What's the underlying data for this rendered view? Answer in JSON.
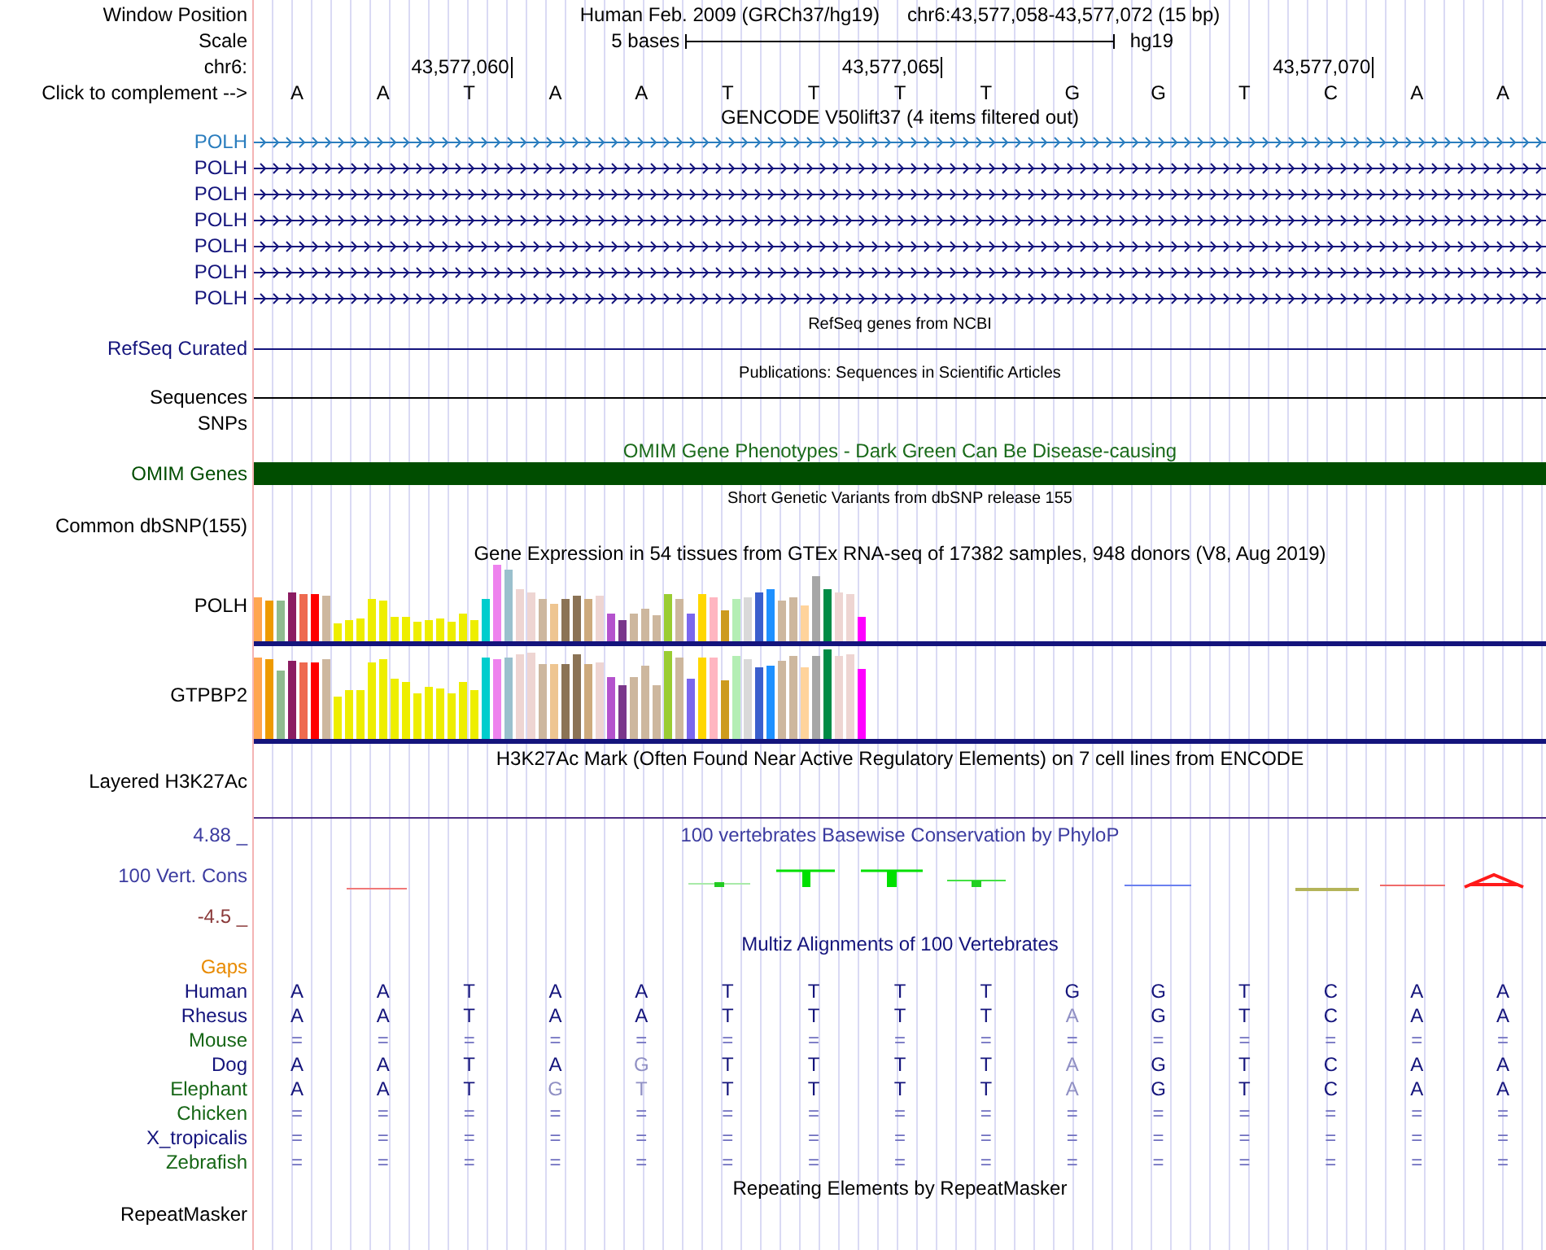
{
  "position": {
    "label": "Window Position",
    "assembly": "Human Feb. 2009 (GRCh37/hg19)",
    "range": "chr6:43,577,058-43,577,072 (15 bp)"
  },
  "scale": {
    "label": "Scale",
    "span": "5 bases",
    "db": "hg19"
  },
  "ruler": {
    "label": "chr6:",
    "ticks": [
      "43,577,060",
      "43,577,065",
      "43,577,070"
    ]
  },
  "bases": {
    "label": "Click to complement -->",
    "letters": [
      "A",
      "A",
      "T",
      "A",
      "A",
      "T",
      "T",
      "T",
      "T",
      "G",
      "G",
      "T",
      "C",
      "A",
      "A"
    ]
  },
  "tracks": [
    {
      "kind": "genes",
      "title": {
        "text": "GENCODE V50lift37 (4 items filtered out)",
        "color": "#000000"
      },
      "rows": [
        {
          "kind": "gene",
          "label": "POLH",
          "color": "#2a7dbe"
        },
        {
          "kind": "gene",
          "label": "POLH",
          "color": "#14147c"
        },
        {
          "kind": "gene",
          "label": "POLH",
          "color": "#14147c"
        },
        {
          "kind": "gene",
          "label": "POLH",
          "color": "#14147c"
        },
        {
          "kind": "gene",
          "label": "POLH",
          "color": "#14147c"
        },
        {
          "kind": "gene",
          "label": "POLH",
          "color": "#14147c"
        },
        {
          "kind": "gene",
          "label": "POLH",
          "color": "#14147c"
        }
      ]
    },
    {
      "kind": "composite",
      "title": {
        "text": "RefSeq genes from NCBI",
        "color": "#000000"
      },
      "rows": [
        {
          "kind": "line",
          "label": "RefSeq Curated",
          "color": "#14147c"
        }
      ]
    },
    {
      "kind": "composite",
      "title": {
        "text": "Publications: Sequences in Scientific Articles",
        "color": "#000000"
      },
      "rows": [
        {
          "kind": "line",
          "label": "Sequences",
          "color": "#000000"
        },
        {
          "kind": "empty",
          "label": "SNPs",
          "color": "#000000"
        }
      ]
    },
    {
      "kind": "standard",
      "title": {
        "text": "OMIM Gene Phenotypes - Dark Green Can Be Disease-causing",
        "color": "#1b6b1b"
      },
      "rows": [
        {
          "kind": "bar",
          "label": "OMIM Genes",
          "color": "#004d00"
        }
      ]
    },
    {
      "kind": "composite",
      "title": {
        "text": "Short Genetic Variants from dbSNP release 155",
        "color": "#000000"
      },
      "rows": [
        {
          "kind": "empty",
          "label": "Common dbSNP(155)",
          "color": "#000000"
        }
      ]
    },
    {
      "kind": "standard",
      "title": {
        "text": "Gene Expression in 54 tissues from GTEx RNA-seq of 17382 samples, 948 donors (V8, Aug 2019)",
        "color": "#000000"
      },
      "rows": [
        {
          "kind": "expression",
          "label": "POLH",
          "color": "#000000"
        },
        {
          "kind": "expression",
          "label": "GTPBP2",
          "color": "#000000"
        }
      ]
    },
    {
      "kind": "standard",
      "title": {
        "text": "H3K27Ac Mark (Often Found Near Active Regulatory Elements) on 7 cell lines from ENCODE",
        "color": "#000000"
      },
      "rows": [
        {
          "kind": "signal",
          "label": "Layered H3K27Ac",
          "color": "#000000"
        }
      ]
    },
    {
      "kind": "conservation",
      "title": {
        "text": "100 vertebrates Basewise Conservation by PhyloP",
        "color": "#3c3ca0"
      },
      "label": "100 Vert. Cons",
      "color": "#3c3ca0",
      "max": "4.88 _",
      "min": {
        "text": "-4.5 _",
        "color": "#8b3a3a"
      }
    },
    {
      "kind": "alignment",
      "title": {
        "text": "Multiz Alignments of 100 Vertebrates",
        "color": "#14147c"
      },
      "rows": [
        {
          "kind": "gaps",
          "label": "Gaps",
          "color": "#e88a00"
        },
        {
          "kind": "aligned",
          "label": "Human",
          "color": "#14147c",
          "bases": [
            {
              "text": "A",
              "mismatch": false
            },
            {
              "text": "A",
              "mismatch": false
            },
            {
              "text": "T",
              "mismatch": false
            },
            {
              "text": "A",
              "mismatch": false
            },
            {
              "text": "A",
              "mismatch": false
            },
            {
              "text": "T",
              "mismatch": false
            },
            {
              "text": "T",
              "mismatch": false
            },
            {
              "text": "T",
              "mismatch": false
            },
            {
              "text": "T",
              "mismatch": false
            },
            {
              "text": "G",
              "mismatch": false
            },
            {
              "text": "G",
              "mismatch": false
            },
            {
              "text": "T",
              "mismatch": false
            },
            {
              "text": "C",
              "mismatch": false
            },
            {
              "text": "A",
              "mismatch": false
            },
            {
              "text": "A",
              "mismatch": false
            }
          ]
        },
        {
          "kind": "aligned",
          "label": "Rhesus",
          "color": "#14147c",
          "bases": [
            {
              "text": "A",
              "mismatch": false
            },
            {
              "text": "A",
              "mismatch": false
            },
            {
              "text": "T",
              "mismatch": false
            },
            {
              "text": "A",
              "mismatch": false
            },
            {
              "text": "A",
              "mismatch": false
            },
            {
              "text": "T",
              "mismatch": false
            },
            {
              "text": "T",
              "mismatch": false
            },
            {
              "text": "T",
              "mismatch": false
            },
            {
              "text": "T",
              "mismatch": false
            },
            {
              "text": "A",
              "mismatch": true
            },
            {
              "text": "G",
              "mismatch": false
            },
            {
              "text": "T",
              "mismatch": false
            },
            {
              "text": "C",
              "mismatch": false
            },
            {
              "text": "A",
              "mismatch": false
            },
            {
              "text": "A",
              "mismatch": false
            }
          ]
        },
        {
          "kind": "unaligned",
          "label": "Mouse",
          "color": "#166616",
          "bases": [
            {
              "text": "=",
              "mismatch": false
            },
            {
              "text": "=",
              "mismatch": false
            },
            {
              "text": "=",
              "mismatch": false
            },
            {
              "text": "=",
              "mismatch": false
            },
            {
              "text": "=",
              "mismatch": false
            },
            {
              "text": "=",
              "mismatch": false
            },
            {
              "text": "=",
              "mismatch": false
            },
            {
              "text": "=",
              "mismatch": false
            },
            {
              "text": "=",
              "mismatch": false
            },
            {
              "text": "=",
              "mismatch": false
            },
            {
              "text": "=",
              "mismatch": false
            },
            {
              "text": "=",
              "mismatch": false
            },
            {
              "text": "=",
              "mismatch": false
            },
            {
              "text": "=",
              "mismatch": false
            },
            {
              "text": "=",
              "mismatch": false
            }
          ]
        },
        {
          "kind": "aligned",
          "label": "Dog",
          "color": "#14147c",
          "bases": [
            {
              "text": "A",
              "mismatch": false
            },
            {
              "text": "A",
              "mismatch": false
            },
            {
              "text": "T",
              "mismatch": false
            },
            {
              "text": "A",
              "mismatch": false
            },
            {
              "text": "G",
              "mismatch": true
            },
            {
              "text": "T",
              "mismatch": false
            },
            {
              "text": "T",
              "mismatch": false
            },
            {
              "text": "T",
              "mismatch": false
            },
            {
              "text": "T",
              "mismatch": false
            },
            {
              "text": "A",
              "mismatch": true
            },
            {
              "text": "G",
              "mismatch": false
            },
            {
              "text": "T",
              "mismatch": false
            },
            {
              "text": "C",
              "mismatch": false
            },
            {
              "text": "A",
              "mismatch": false
            },
            {
              "text": "A",
              "mismatch": false
            }
          ]
        },
        {
          "kind": "aligned",
          "label": "Elephant",
          "color": "#166616",
          "bases": [
            {
              "text": "A",
              "mismatch": false
            },
            {
              "text": "A",
              "mismatch": false
            },
            {
              "text": "T",
              "mismatch": false
            },
            {
              "text": "G",
              "mismatch": true
            },
            {
              "text": "T",
              "mismatch": true
            },
            {
              "text": "T",
              "mismatch": false
            },
            {
              "text": "T",
              "mismatch": false
            },
            {
              "text": "T",
              "mismatch": false
            },
            {
              "text": "T",
              "mismatch": false
            },
            {
              "text": "A",
              "mismatch": true
            },
            {
              "text": "G",
              "mismatch": false
            },
            {
              "text": "T",
              "mismatch": false
            },
            {
              "text": "C",
              "mismatch": false
            },
            {
              "text": "A",
              "mismatch": false
            },
            {
              "text": "A",
              "mismatch": false
            }
          ]
        },
        {
          "kind": "unaligned",
          "label": "Chicken",
          "color": "#166616",
          "bases": [
            {
              "text": "=",
              "mismatch": false
            },
            {
              "text": "=",
              "mismatch": false
            },
            {
              "text": "=",
              "mismatch": false
            },
            {
              "text": "=",
              "mismatch": false
            },
            {
              "text": "=",
              "mismatch": false
            },
            {
              "text": "=",
              "mismatch": false
            },
            {
              "text": "=",
              "mismatch": false
            },
            {
              "text": "=",
              "mismatch": false
            },
            {
              "text": "=",
              "mismatch": false
            },
            {
              "text": "=",
              "mismatch": false
            },
            {
              "text": "=",
              "mismatch": false
            },
            {
              "text": "=",
              "mismatch": false
            },
            {
              "text": "=",
              "mismatch": false
            },
            {
              "text": "=",
              "mismatch": false
            },
            {
              "text": "=",
              "mismatch": false
            }
          ]
        },
        {
          "kind": "unaligned",
          "label": "X_tropicalis",
          "color": "#14147c",
          "bases": [
            {
              "text": "=",
              "mismatch": false
            },
            {
              "text": "=",
              "mismatch": false
            },
            {
              "text": "=",
              "mismatch": false
            },
            {
              "text": "=",
              "mismatch": false
            },
            {
              "text": "=",
              "mismatch": false
            },
            {
              "text": "=",
              "mismatch": false
            },
            {
              "text": "=",
              "mismatch": false
            },
            {
              "text": "=",
              "mismatch": false
            },
            {
              "text": "=",
              "mismatch": false
            },
            {
              "text": "=",
              "mismatch": false
            },
            {
              "text": "=",
              "mismatch": false
            },
            {
              "text": "=",
              "mismatch": false
            },
            {
              "text": "=",
              "mismatch": false
            },
            {
              "text": "=",
              "mismatch": false
            },
            {
              "text": "=",
              "mismatch": false
            }
          ]
        },
        {
          "kind": "unaligned",
          "label": "Zebrafish",
          "color": "#166616",
          "bases": [
            {
              "text": "=",
              "mismatch": false
            },
            {
              "text": "=",
              "mismatch": false
            },
            {
              "text": "=",
              "mismatch": false
            },
            {
              "text": "=",
              "mismatch": false
            },
            {
              "text": "=",
              "mismatch": false
            },
            {
              "text": "=",
              "mismatch": false
            },
            {
              "text": "=",
              "mismatch": false
            },
            {
              "text": "=",
              "mismatch": false
            },
            {
              "text": "=",
              "mismatch": false
            },
            {
              "text": "=",
              "mismatch": false
            },
            {
              "text": "=",
              "mismatch": false
            },
            {
              "text": "=",
              "mismatch": false
            },
            {
              "text": "=",
              "mismatch": false
            },
            {
              "text": "=",
              "mismatch": false
            },
            {
              "text": "=",
              "mismatch": false
            }
          ]
        }
      ]
    },
    {
      "kind": "standard",
      "title": {
        "text": "Repeating Elements by RepeatMasker",
        "color": "#000000"
      },
      "rows": [
        {
          "kind": "empty",
          "label": "RepeatMasker",
          "color": "#000000"
        }
      ]
    }
  ]
}
